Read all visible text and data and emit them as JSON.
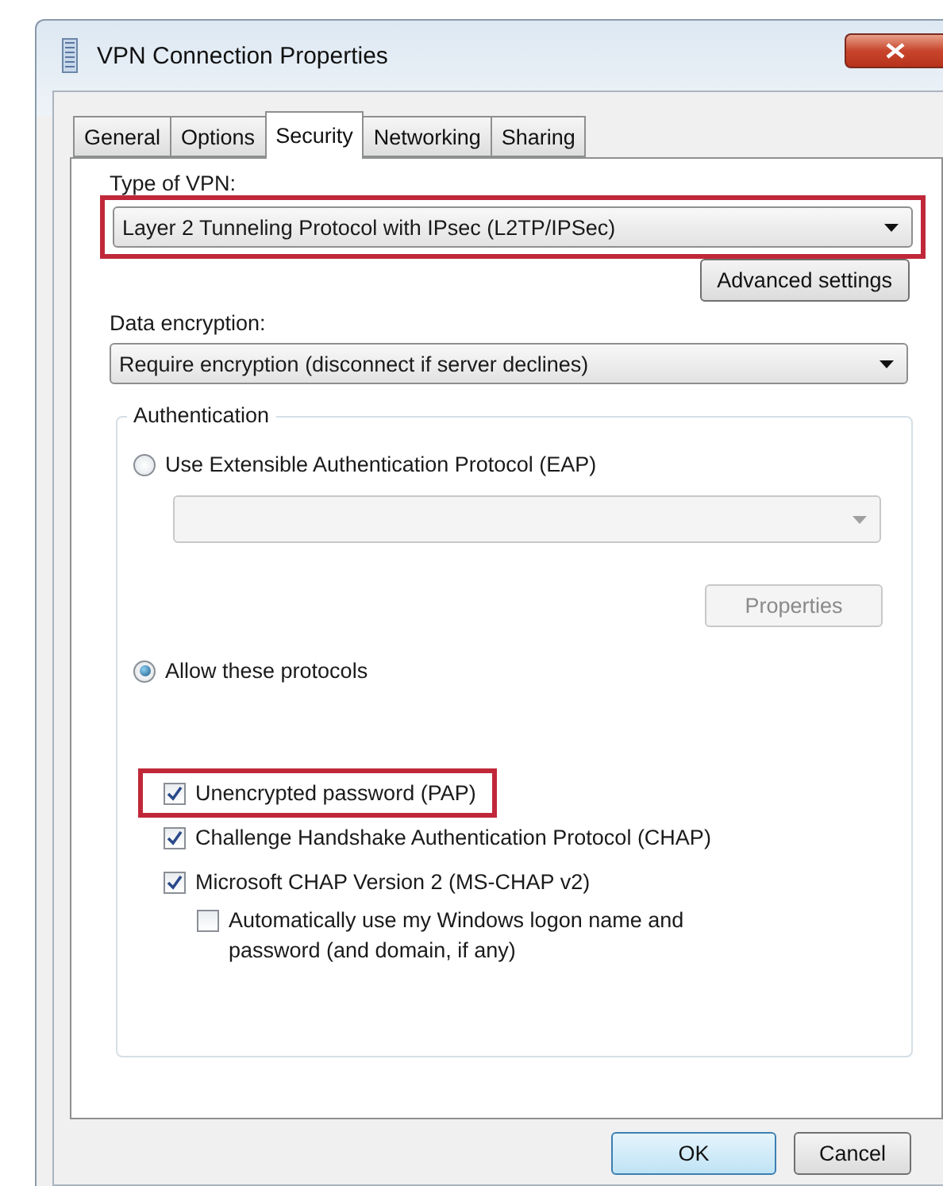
{
  "window": {
    "title": "VPN Connection Properties"
  },
  "tabs": [
    {
      "label": "General",
      "selected": false
    },
    {
      "label": "Options",
      "selected": false
    },
    {
      "label": "Security",
      "selected": true
    },
    {
      "label": "Networking",
      "selected": false
    },
    {
      "label": "Sharing",
      "selected": false
    }
  ],
  "vpn_type": {
    "label": "Type of VPN:",
    "value": "Layer 2 Tunneling Protocol with IPsec (L2TP/IPSec)",
    "highlighted": true
  },
  "advanced_button": {
    "label": "Advanced settings"
  },
  "data_encryption": {
    "label": "Data encryption:",
    "value": "Require encryption (disconnect if server declines)"
  },
  "authentication": {
    "title": "Authentication",
    "eap_radio": {
      "label": "Use Extensible Authentication Protocol (EAP)",
      "selected": false
    },
    "eap_dropdown": {
      "disabled": true
    },
    "properties_button": {
      "label": "Properties",
      "disabled": true
    },
    "allow_radio": {
      "label": "Allow these protocols",
      "selected": true
    },
    "protocols": [
      {
        "label": "Unencrypted password (PAP)",
        "checked": true,
        "highlighted": true
      },
      {
        "label": "Challenge Handshake Authentication Protocol (CHAP)",
        "checked": true,
        "highlighted": false
      },
      {
        "label": "Microsoft CHAP Version 2 (MS-CHAP v2)",
        "checked": true,
        "highlighted": false
      }
    ],
    "logon_checkbox": {
      "label": "Automatically use my Windows logon name and password (and domain, if any)",
      "checked": false
    }
  },
  "buttons": [
    {
      "label": "OK",
      "default": true
    },
    {
      "label": "Cancel",
      "default": false
    }
  ]
}
